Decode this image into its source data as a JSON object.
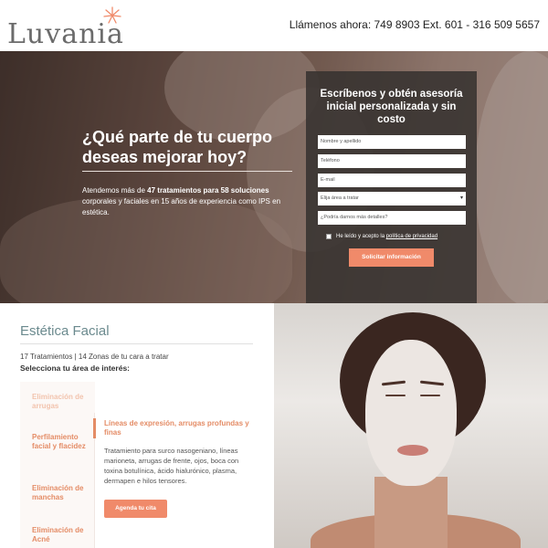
{
  "header": {
    "logo_text": "Luvania",
    "phone": "Llámenos ahora: 749 8903 Ext. 601 - 316 509 5657",
    "accent_color": "#f08a6a"
  },
  "hero": {
    "title": "¿Qué parte de tu cuerpo deseas mejorar hoy?",
    "desc_prefix": "Atendemos más de ",
    "desc_bold1": "47 tratamientos para 58 soluciones",
    "desc_mid": " corporales y faciales en 15 años de experiencia como IPS en estética."
  },
  "form": {
    "title": "Escríbenos y obtén asesoría inicial personalizada y sin costo",
    "name_placeholder": "Nombre y apellido",
    "phone_placeholder": "Teléfono",
    "email_placeholder": "E-mail",
    "area_select": "Elija área a tratar",
    "details_placeholder": "¿Podría darnos más detalles?",
    "consent_prefix": "He leído y acepto la ",
    "consent_link": "política de privacidad",
    "submit_label": "Solicitar información"
  },
  "facial": {
    "title": "Estética Facial",
    "meta": "17 Tratamientos | 14 Zonas de tu cara a tratar",
    "prompt": "Selecciona tu área de interés:",
    "areas": [
      {
        "label": "Eliminación de arrugas"
      },
      {
        "label": "Perfilamiento facial y flacidez"
      },
      {
        "label": "Eliminación de manchas"
      },
      {
        "label": "Eliminación de Acné"
      }
    ],
    "detail_title": "Líneas de expresión, arrugas profundas y finas",
    "detail_desc": "Tratamiento para surco nasogeniano, líneas marioneta, arrugas de frente, ojos, boca con toxina botulínica, ácido hialurónico, plasma, dermapen e hilos tensores.",
    "cta_label": "Agenda tu cita"
  }
}
